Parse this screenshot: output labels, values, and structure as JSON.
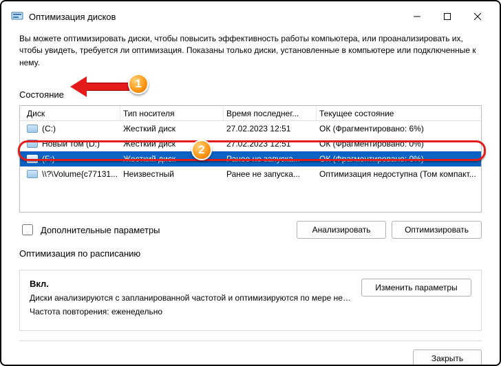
{
  "titlebar": {
    "title": "Оптимизация дисков"
  },
  "description": "Вы можете оптимизировать диски, чтобы повысить эффективность работы  компьютера, или проанализировать их, чтобы увидеть, требуется ли оптимизация. Показаны только диски, установленные в компьютере или подключенные к нему.",
  "status_label": "Состояние",
  "columns": {
    "disk": "Диск",
    "media": "Тип носителя",
    "last": "Время последнег...",
    "state": "Текущее состояние"
  },
  "rows": [
    {
      "name": "(C:)",
      "media": "Жесткий диск",
      "last": "27.02.2023 12:51",
      "state": "ОК (Фрагментировано: 6%)"
    },
    {
      "name": "Новый том (D:)",
      "media": "Жесткий диск",
      "last": "27.02.2023 12:51",
      "state": "ОК (Фрагментировано: 0%)"
    },
    {
      "name": "(F:)",
      "media": "Жесткий диск",
      "last": "Ранее не запуска...",
      "state": "ОК (Фрагментировано: 0%)"
    },
    {
      "name": "\\\\?\\Volume{c77131...",
      "media": "Неизвестный",
      "last": "Ранее не запуска...",
      "state": "Оптимизация недоступна (Том компакт..."
    }
  ],
  "advanced_label": "Дополнительные параметры",
  "buttons": {
    "analyze": "Анализировать",
    "optimize": "Оптимизировать",
    "change": "Изменить параметры",
    "close": "Закрыть"
  },
  "schedule_label": "Оптимизация по расписанию",
  "schedule": {
    "on": "Вкл.",
    "line1": "Диски анализируются с запланированной частотой и оптимизируются по мере необход...",
    "line2": "Частота повторения: еженедельно"
  },
  "badges": {
    "b1": "1",
    "b2": "2"
  }
}
